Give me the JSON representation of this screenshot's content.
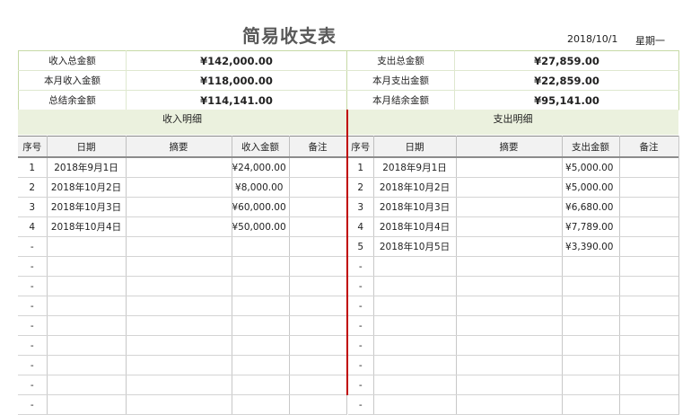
{
  "header": {
    "title": "简易收支表",
    "date": "2018/10/1",
    "weekday": "星期一"
  },
  "summary": [
    {
      "left_label": "收入总金额",
      "left_value": "¥142,000.00",
      "right_label": "支出总金额",
      "right_value": "¥27,859.00"
    },
    {
      "left_label": "本月收入金额",
      "left_value": "¥118,000.00",
      "right_label": "本月支出金额",
      "right_value": "¥22,859.00"
    },
    {
      "left_label": "总结余金额",
      "left_value": "¥114,141.00",
      "right_label": "本月结余金额",
      "right_value": "¥95,141.00"
    }
  ],
  "income": {
    "title": "收入明细",
    "columns": [
      "序号",
      "日期",
      "摘要",
      "收入金额",
      "备注"
    ],
    "rows": [
      {
        "no": "1",
        "date": "2018年9月1日",
        "summary": "",
        "amount": "¥24,000.00",
        "note": ""
      },
      {
        "no": "2",
        "date": "2018年10月2日",
        "summary": "",
        "amount": "¥8,000.00",
        "note": ""
      },
      {
        "no": "3",
        "date": "2018年10月3日",
        "summary": "",
        "amount": "¥60,000.00",
        "note": ""
      },
      {
        "no": "4",
        "date": "2018年10月4日",
        "summary": "",
        "amount": "¥50,000.00",
        "note": ""
      },
      {
        "no": "-",
        "date": "",
        "summary": "",
        "amount": "",
        "note": ""
      },
      {
        "no": "-",
        "date": "",
        "summary": "",
        "amount": "",
        "note": ""
      },
      {
        "no": "-",
        "date": "",
        "summary": "",
        "amount": "",
        "note": ""
      },
      {
        "no": "-",
        "date": "",
        "summary": "",
        "amount": "",
        "note": ""
      },
      {
        "no": "-",
        "date": "",
        "summary": "",
        "amount": "",
        "note": ""
      },
      {
        "no": "-",
        "date": "",
        "summary": "",
        "amount": "",
        "note": ""
      },
      {
        "no": "-",
        "date": "",
        "summary": "",
        "amount": "",
        "note": ""
      },
      {
        "no": "-",
        "date": "",
        "summary": "",
        "amount": "",
        "note": ""
      },
      {
        "no": "-",
        "date": "",
        "summary": "",
        "amount": "",
        "note": ""
      }
    ]
  },
  "expense": {
    "title": "支出明细",
    "columns": [
      "序号",
      "日期",
      "摘要",
      "支出金额",
      "备注"
    ],
    "rows": [
      {
        "no": "1",
        "date": "2018年9月1日",
        "summary": "",
        "amount": "¥5,000.00",
        "note": ""
      },
      {
        "no": "2",
        "date": "2018年10月2日",
        "summary": "",
        "amount": "¥5,000.00",
        "note": ""
      },
      {
        "no": "3",
        "date": "2018年10月3日",
        "summary": "",
        "amount": "¥6,680.00",
        "note": ""
      },
      {
        "no": "4",
        "date": "2018年10月4日",
        "summary": "",
        "amount": "¥7,789.00",
        "note": ""
      },
      {
        "no": "5",
        "date": "2018年10月5日",
        "summary": "",
        "amount": "¥3,390.00",
        "note": ""
      },
      {
        "no": "-",
        "date": "",
        "summary": "",
        "amount": "",
        "note": ""
      },
      {
        "no": "-",
        "date": "",
        "summary": "",
        "amount": "",
        "note": ""
      },
      {
        "no": "-",
        "date": "",
        "summary": "",
        "amount": "",
        "note": ""
      },
      {
        "no": "-",
        "date": "",
        "summary": "",
        "amount": "",
        "note": ""
      },
      {
        "no": "-",
        "date": "",
        "summary": "",
        "amount": "",
        "note": ""
      },
      {
        "no": "-",
        "date": "",
        "summary": "",
        "amount": "",
        "note": ""
      },
      {
        "no": "-",
        "date": "",
        "summary": "",
        "amount": "",
        "note": ""
      },
      {
        "no": "-",
        "date": "",
        "summary": "",
        "amount": "",
        "note": ""
      }
    ]
  }
}
